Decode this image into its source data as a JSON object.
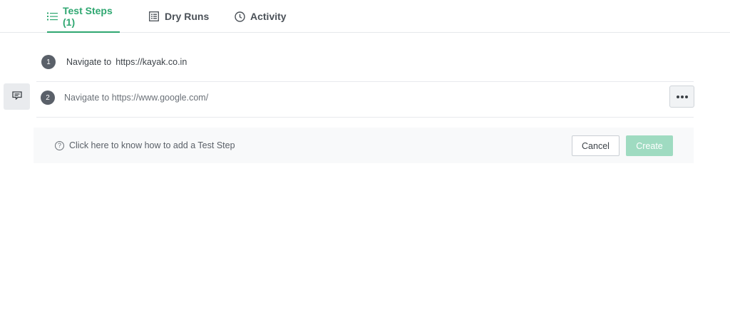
{
  "tabs": [
    {
      "label": "Test Steps (1)",
      "icon": "list-icon",
      "active": true
    },
    {
      "label": "Dry Runs",
      "icon": "dry-runs-icon",
      "active": false
    },
    {
      "label": "Activity",
      "icon": "clock-icon",
      "active": false
    }
  ],
  "steps": [
    {
      "number": "1",
      "action": "Navigate to",
      "url": "https://kayak.co.in"
    },
    {
      "number": "2",
      "value": "Navigate to https://www.google.com/"
    }
  ],
  "footer": {
    "help_text": "Click here to know how to add a Test Step",
    "cancel_label": "Cancel",
    "create_label": "Create"
  },
  "colors": {
    "accent": "#2fa771",
    "create_disabled": "#9fdbc1",
    "step_badge": "#5a6069"
  }
}
